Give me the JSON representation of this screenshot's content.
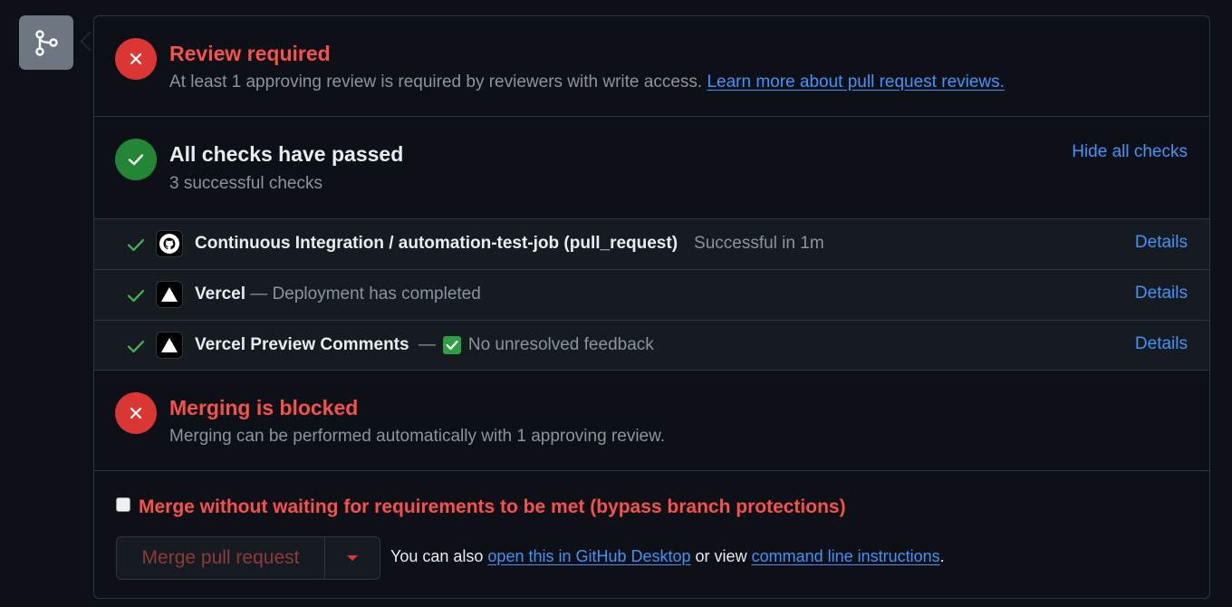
{
  "review": {
    "title": "Review required",
    "subtitle": "At least 1 approving review is required by reviewers with write access.",
    "link": "Learn more about pull request reviews."
  },
  "checks": {
    "title": "All checks have passed",
    "subtitle": "3 successful checks",
    "toggle": "Hide all checks",
    "items": [
      {
        "name": "Continuous Integration / automation-test-job (pull_request)",
        "separator": "",
        "status": "Successful in 1m",
        "details": "Details",
        "icon": "github-icon"
      },
      {
        "name": "Vercel",
        "separator": " — ",
        "status": "Deployment has completed",
        "details": "Details",
        "icon": "vercel-icon"
      },
      {
        "name": "Vercel Preview Comments",
        "separator": " —",
        "status": "No unresolved feedback",
        "details": "Details",
        "icon": "vercel-icon"
      }
    ]
  },
  "merge_block": {
    "title": "Merging is blocked",
    "subtitle": "Merging can be performed automatically with 1 approving review."
  },
  "bypass": {
    "label": "Merge without waiting for requirements to be met (bypass branch protections)",
    "checked": false
  },
  "merge": {
    "button": "Merge pull request",
    "also_prefix": "You can also ",
    "desktop_link": "open this in GitHub Desktop",
    "middle": " or view ",
    "cli_link": "command line instructions",
    "suffix": "."
  },
  "colors": {
    "danger": "#da3633",
    "success": "#238636",
    "link": "#4493f8",
    "background": "#0d1117"
  }
}
